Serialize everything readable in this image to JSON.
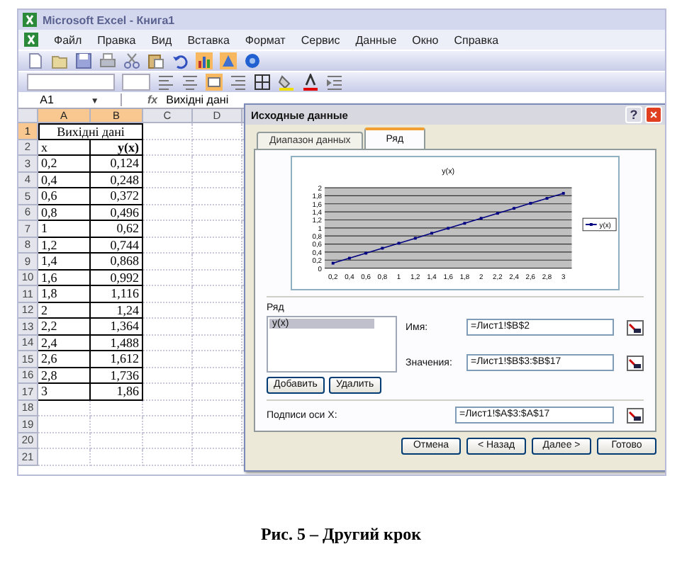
{
  "window": {
    "title": "Microsoft Excel - Книга1"
  },
  "menu": [
    "Файл",
    "Правка",
    "Вид",
    "Вставка",
    "Формат",
    "Сервис",
    "Данные",
    "Окно",
    "Справка"
  ],
  "formula_bar": {
    "cell": "A1",
    "dropdown": "▼",
    "function": "fx",
    "content": "Вихідні дані"
  },
  "sheet": {
    "columns": [
      {
        "label": "A",
        "selected": true
      },
      {
        "label": "B",
        "selected": true
      },
      {
        "label": "C",
        "selected": false
      },
      {
        "label": "D",
        "selected": false
      }
    ],
    "rows": [
      {
        "label": "1",
        "selected": true
      },
      {
        "label": "2",
        "selected": false
      },
      {
        "label": "3",
        "selected": false
      },
      {
        "label": "4",
        "selected": false
      },
      {
        "label": "5",
        "selected": false
      },
      {
        "label": "6",
        "selected": false
      },
      {
        "label": "7",
        "selected": false
      },
      {
        "label": "8",
        "selected": false
      },
      {
        "label": "9",
        "selected": false
      },
      {
        "label": "10",
        "selected": false
      },
      {
        "label": "11",
        "selected": false
      },
      {
        "label": "12",
        "selected": false
      },
      {
        "label": "13",
        "selected": false
      },
      {
        "label": "14",
        "selected": false
      },
      {
        "label": "15",
        "selected": false
      },
      {
        "label": "16",
        "selected": false
      },
      {
        "label": "17",
        "selected": false
      },
      {
        "label": "18",
        "selected": false
      },
      {
        "label": "19",
        "selected": false
      },
      {
        "label": "20",
        "selected": false
      },
      {
        "label": "21",
        "selected": false
      }
    ],
    "title_cell": "Вихідні дані",
    "header": [
      "x",
      "y(x)"
    ],
    "data": [
      [
        "0,2",
        "0,124"
      ],
      [
        "0,4",
        "0,248"
      ],
      [
        "0,6",
        "0,372"
      ],
      [
        "0,8",
        "0,496"
      ],
      [
        "1",
        "0,62"
      ],
      [
        "1,2",
        "0,744"
      ],
      [
        "1,4",
        "0,868"
      ],
      [
        "1,6",
        "0,992"
      ],
      [
        "1,8",
        "1,116"
      ],
      [
        "2",
        "1,24"
      ],
      [
        "2,2",
        "1,364"
      ],
      [
        "2,4",
        "1,488"
      ],
      [
        "2,6",
        "1,612"
      ],
      [
        "2,8",
        "1,736"
      ],
      [
        "3",
        "1,86"
      ]
    ]
  },
  "dialog": {
    "title": "Исходные данные",
    "title_buttons": [
      "?",
      "×"
    ],
    "tabs": [
      {
        "label": "Диапазон данных",
        "selected": false
      },
      {
        "label": "Ряд",
        "selected": true
      }
    ],
    "chart_data": {
      "type": "line",
      "title": "y(x)",
      "categories": [
        "0,2",
        "0,4",
        "0,6",
        "0,8",
        "1",
        "1,2",
        "1,4",
        "1,6",
        "1,8",
        "2",
        "2,2",
        "2,4",
        "2,6",
        "2,8",
        "3"
      ],
      "grid": true,
      "series": [
        {
          "name": "y(x)",
          "color": "#000080",
          "marker": "square",
          "values": [
            0.124,
            0.248,
            0.372,
            0.496,
            0.62,
            0.744,
            0.868,
            0.992,
            1.116,
            1.24,
            1.364,
            1.488,
            1.612,
            1.736,
            1.86
          ]
        }
      ],
      "ylim": [
        0,
        2
      ],
      "yticks": [
        {
          "value": 0,
          "label": "0"
        },
        {
          "value": 0.2,
          "label": "0,2"
        },
        {
          "value": 0.4,
          "label": "0,4"
        },
        {
          "value": 0.6,
          "label": "0,6"
        },
        {
          "value": 0.8,
          "label": "0,8"
        },
        {
          "value": 1,
          "label": "1"
        },
        {
          "value": 1.2,
          "label": "1,2"
        },
        {
          "value": 1.4,
          "label": "1,4"
        },
        {
          "value": 1.6,
          "label": "1,6"
        },
        {
          "value": 1.8,
          "label": "1,8"
        },
        {
          "value": 2,
          "label": "2"
        }
      ]
    },
    "series_label": "Ряд",
    "series_list": [
      {
        "label": "y(x)",
        "selected": true
      }
    ],
    "series_buttons": [
      "Добавить",
      "Удалить"
    ],
    "fields": [
      {
        "label": "Имя:",
        "value": "=Лист1!$B$2"
      },
      {
        "label": "Значения:",
        "value": "=Лист1!$B$3:$B$17"
      }
    ],
    "x_labels_field": {
      "label": "Подписи оси X:",
      "value": "=Лист1!$A$3:$A$17"
    },
    "buttons": [
      "Отмена",
      "< Назад",
      "Далее >",
      "Готово"
    ]
  },
  "caption": "Рис. 5 – Другий крок"
}
